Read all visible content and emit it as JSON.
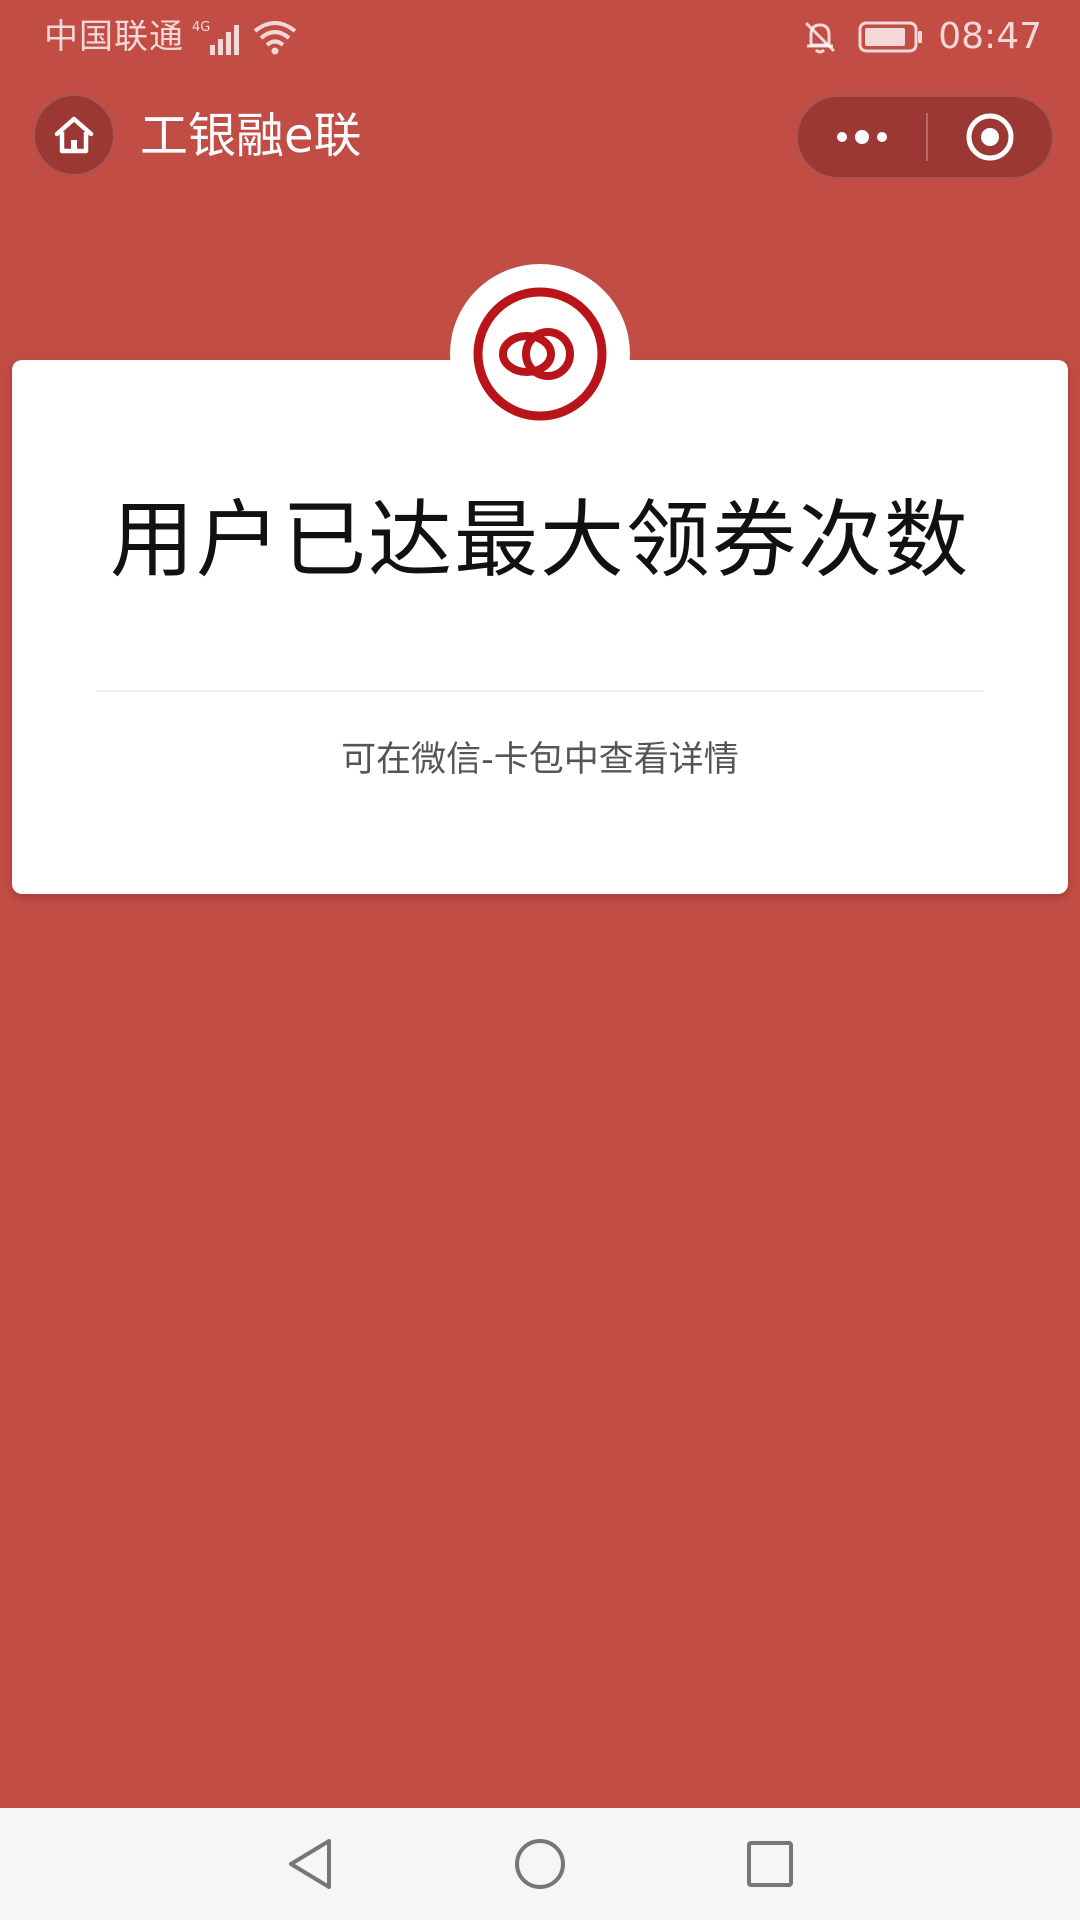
{
  "status_bar": {
    "carrier": "中国联通",
    "network": "4G",
    "time": "08:47"
  },
  "nav": {
    "title": "工银融e联",
    "home_icon": "home-icon",
    "more_icon": "more-dots-icon",
    "close_icon": "target-circle-icon"
  },
  "card": {
    "title": "用户已达最大领券次数",
    "subtitle": "可在微信-卡包中查看详情",
    "logo_icon": "icbc-rings-logo-icon"
  },
  "colors": {
    "background": "#c24d45",
    "card": "#ffffff",
    "logo_red": "#b8141a",
    "capsule": "#9c3833"
  }
}
